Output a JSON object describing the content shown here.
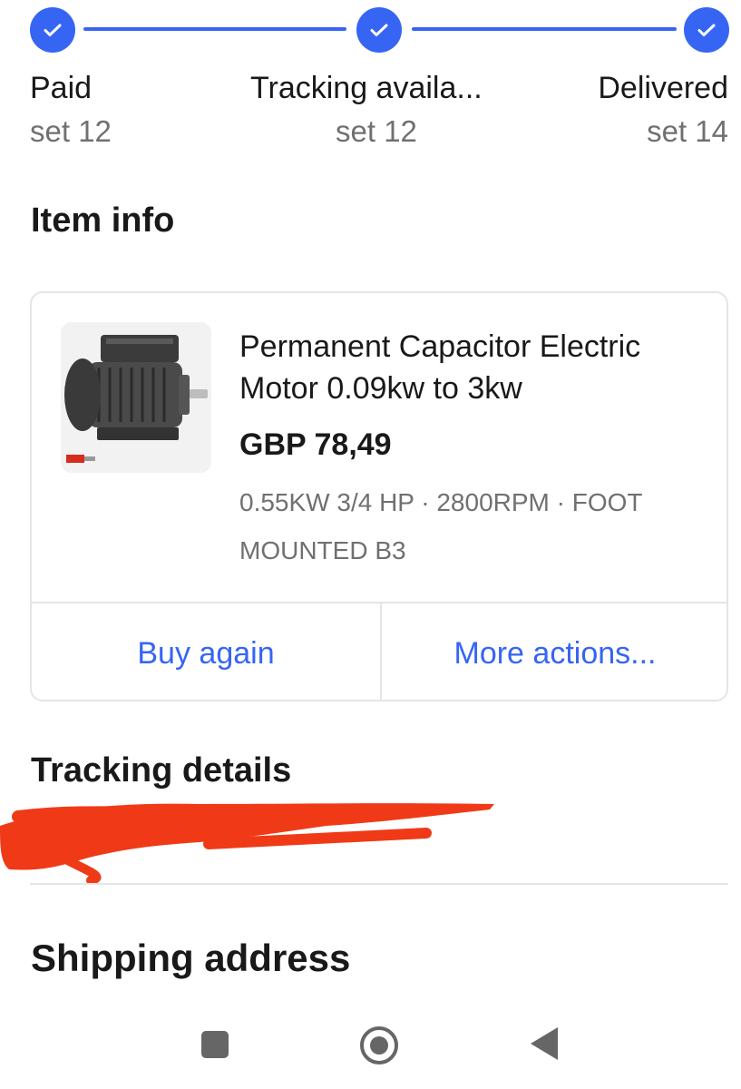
{
  "progress": {
    "steps": [
      {
        "label": "Paid",
        "date": "set 12",
        "complete": true
      },
      {
        "label": "Tracking availa...",
        "date": "set 12",
        "complete": true
      },
      {
        "label": "Delivered",
        "date": "set 14",
        "complete": true
      }
    ]
  },
  "item_info": {
    "heading": "Item info",
    "title": "Permanent Capacitor Electric Motor 0.09kw to 3kw",
    "price": "GBP 78,49",
    "variant": "0.55KW 3/4 HP · 2800RPM · FOOT MOUNTED B3",
    "buy_again_label": "Buy again",
    "more_actions_label": "More actions..."
  },
  "tracking": {
    "heading": "Tracking details"
  },
  "shipping": {
    "heading": "Shipping address"
  },
  "colors": {
    "accent": "#3665f3",
    "redaction": "#f03a17",
    "secondary_text": "#707070"
  },
  "icons": [
    "check-icon",
    "recent-apps-icon",
    "home-icon",
    "back-icon"
  ]
}
